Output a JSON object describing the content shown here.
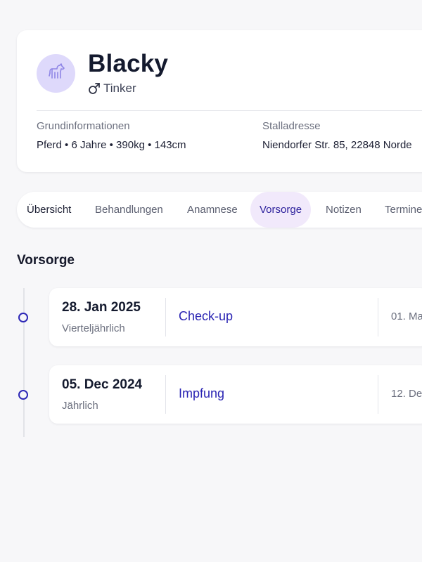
{
  "profile": {
    "name": "Blacky",
    "gender_symbol": "♂",
    "breed": "Tinker",
    "avatar_icon": "horse-icon",
    "basic_info": {
      "label": "Grundinformationen",
      "value": "Pferd • 6 Jahre • 390kg • 143cm"
    },
    "stable_address": {
      "label": "Stalladresse",
      "value": "Niendorfer Str. 85, 22848 Norde"
    }
  },
  "tabs": [
    {
      "label": "Übersicht",
      "active": false
    },
    {
      "label": "Behandlungen",
      "active": false
    },
    {
      "label": "Anamnese",
      "active": false
    },
    {
      "label": "Vorsorge",
      "active": true
    },
    {
      "label": "Notizen",
      "active": false
    },
    {
      "label": "Termine",
      "active": false
    }
  ],
  "section": {
    "title": "Vorsorge"
  },
  "entries": [
    {
      "date": "28. Jan 2025",
      "frequency": "Vierteljährlich",
      "type": "Check-up",
      "next": "01. Ma"
    },
    {
      "date": "05. Dec 2024",
      "frequency": "Jährlich",
      "type": "Impfung",
      "next": "12. De"
    }
  ],
  "colors": {
    "accent": "#2d27b6",
    "active_tab_bg": "#f1e9fb",
    "avatar_bg": "#ded9fb",
    "page_bg": "#f7f7f9"
  }
}
